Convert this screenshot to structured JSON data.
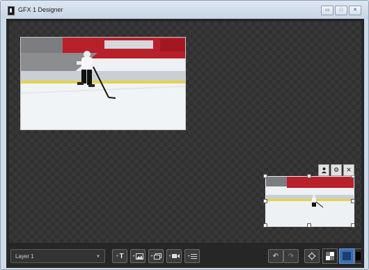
{
  "window": {
    "title": "GFX 1 Designer",
    "controls": {
      "minimize": "▭",
      "maximize": "□",
      "close": "✕"
    }
  },
  "canvas": {
    "sources": [
      {
        "name": "hockey-video-main"
      },
      {
        "name": "hockey-video-pip"
      }
    ],
    "layer_tools": [
      {
        "icon": "person-icon"
      },
      {
        "icon": "gear-icon"
      },
      {
        "icon": "close-icon"
      }
    ]
  },
  "toolbar": {
    "layer_select": {
      "value": "Layer 1"
    },
    "add_buttons": [
      {
        "icon": "add-text-icon",
        "glyph": "T"
      },
      {
        "icon": "add-image-icon"
      },
      {
        "icon": "add-media-icon"
      },
      {
        "icon": "add-video-icon"
      },
      {
        "icon": "add-list-icon"
      }
    ],
    "undo_icon": "undo-icon",
    "redo_icon": "redo-icon",
    "fit_icon": "fit-view-icon",
    "view_modes": [
      {
        "icon": "checker-background-icon",
        "active": false
      },
      {
        "icon": "blue-background-icon",
        "active": true
      },
      {
        "icon": "black-background-icon",
        "active": false
      }
    ]
  }
}
